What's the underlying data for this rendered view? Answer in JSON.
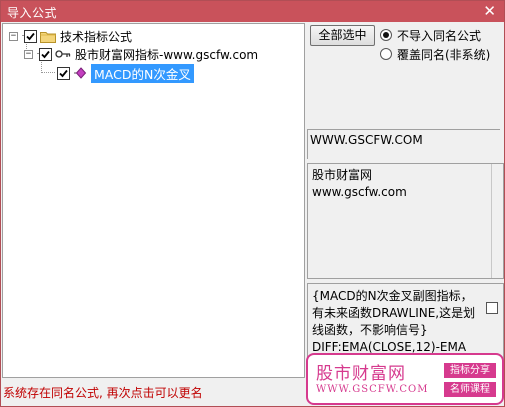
{
  "window": {
    "title": "导入公式",
    "close_glyph": "✕"
  },
  "tree": {
    "root": {
      "label": "技术指标公式",
      "expander": "−",
      "checked": true,
      "icon": "folder-icon"
    },
    "group": {
      "label": "股市财富网指标-www.gscfw.com",
      "expander": "−",
      "checked": true,
      "icon": "key-icon"
    },
    "item": {
      "label": "MACD的N次金叉",
      "checked": true,
      "icon": "formula-diamond-icon",
      "selected": true
    }
  },
  "controls": {
    "select_all": "全部选中",
    "radio_options": [
      {
        "label": "不导入同名公式",
        "checked": true
      },
      {
        "label": "覆盖同名(非系统)",
        "checked": false
      }
    ]
  },
  "info": {
    "url": "WWW.GSCFW.COM",
    "desc_lines": [
      "股市财富网",
      "www.gscfw.com"
    ],
    "notes_lines": [
      "{MACD的N次金叉副图指标，",
      "有未来函数DRAWLINE,这是划",
      "线函数，不影响信号}",
      "DIFF:EMA(CLOSE,12)-EMA"
    ]
  },
  "status": "系统存在同名公式, 再次点击可以更名",
  "brand": {
    "name": "股市财富网",
    "domain": "WWW.GSCFW.COM",
    "tag1": "指标分享",
    "tag2": "名师课程"
  },
  "colors": {
    "titlebar": "#c9525b",
    "selection": "#3399ff",
    "status": "#c00000",
    "brand": "#d63a8e"
  }
}
